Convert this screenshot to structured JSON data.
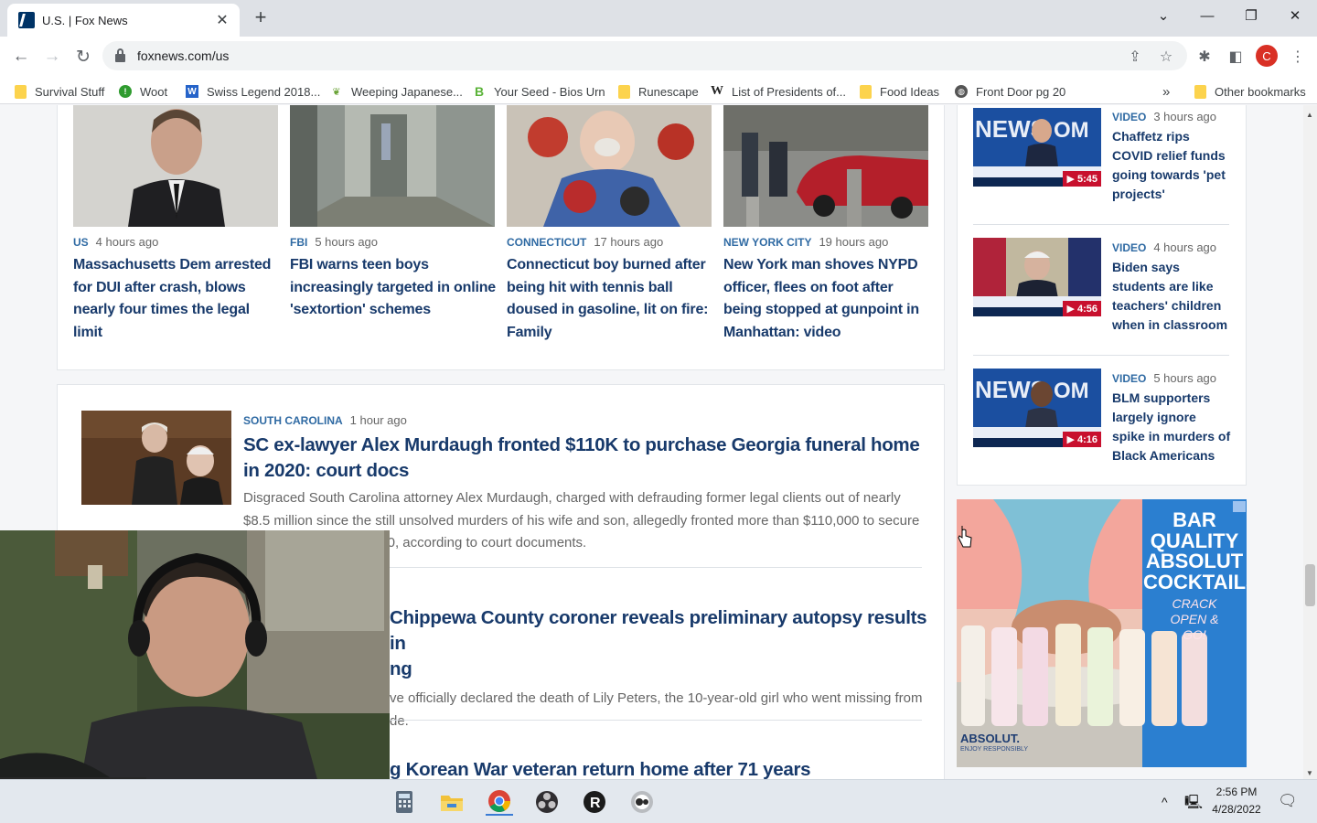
{
  "browser": {
    "tab_title": "U.S. | Fox News",
    "url": "foxnews.com/us",
    "profile_initial": "C",
    "bookmarks": [
      {
        "label": "Survival Stuff",
        "icon": "folder-icon"
      },
      {
        "label": "Woot",
        "icon": "woot-icon"
      },
      {
        "label": "Swiss Legend 2018...",
        "icon": "w-site-icon"
      },
      {
        "label": "Weeping Japanese...",
        "icon": "leaf-icon"
      },
      {
        "label": "Your Seed - Bios Urn",
        "icon": "b-site-icon"
      },
      {
        "label": "Runescape",
        "icon": "folder-icon"
      },
      {
        "label": "List of Presidents of...",
        "icon": "wikipedia-icon"
      },
      {
        "label": "Food Ideas",
        "icon": "folder-icon"
      },
      {
        "label": "Front Door pg 20",
        "icon": "globe-icon"
      }
    ],
    "bookmarks_overflow": "»",
    "other_bookmarks": "Other bookmarks"
  },
  "top_stories": [
    {
      "kicker": "US",
      "time": "4 hours ago",
      "headline": "Massachusetts Dem arrested for DUI after crash, blows nearly four times the legal limit"
    },
    {
      "kicker": "FBI",
      "time": "5 hours ago",
      "headline": "FBI warns teen boys increasingly targeted in online 'sextortion' schemes"
    },
    {
      "kicker": "CONNECTICUT",
      "time": "17 hours ago",
      "headline": "Connecticut boy burned after being hit with tennis ball doused in gasoline, lit on fire: Family"
    },
    {
      "kicker": "NEW YORK CITY",
      "time": "19 hours ago",
      "headline": "New York man shoves NYPD officer, flees on foot after being stopped at gunpoint in Manhattan: video"
    }
  ],
  "list_stories": [
    {
      "kicker": "SOUTH CAROLINA",
      "time": "1 hour ago",
      "headline": "SC ex-lawyer Alex Murdaugh fronted $110K to purchase Georgia funeral home in 2020: court docs",
      "dek": "Disgraced South Carolina attorney Alex Murdaugh, charged with defrauding former legal clients out of nearly $8.5 million since the still unsolved murders of his wife and son, allegedly fronted more than $110,000 to secure the funeral home in 2020, according to court documents."
    },
    {
      "headline_visible": "Chippewa County coroner reveals preliminary autopsy results in",
      "headline_line2": "ng",
      "dek_line1": "ve officially declared the death of Lily Peters, the 10-year-old girl who went missing from",
      "dek_line2": "de."
    },
    {
      "headline_visible": "g Korean War veteran return home after 71 years"
    }
  ],
  "videos": [
    {
      "kicker": "VIDEO",
      "time": "3 hours ago",
      "headline": "Chaffetz rips COVID relief funds going towards 'pet projects'",
      "duration": "5:45"
    },
    {
      "kicker": "VIDEO",
      "time": "4 hours ago",
      "headline": "Biden says students are like teachers' children when in classroom",
      "duration": "4:56"
    },
    {
      "kicker": "VIDEO",
      "time": "5 hours ago",
      "headline": "BLM supporters largely ignore spike in murders of Black Americans",
      "duration": "4:16"
    }
  ],
  "ad": {
    "headline_lines": [
      "BAR",
      "QUALITY",
      "ABSOLUT",
      "COCKTAILS"
    ],
    "tagline": "CRACK OPEN & GO!",
    "brand": "ABSOLUT.",
    "fine_print": "ENJOY RESPONSIBLY"
  },
  "taskbar": {
    "time": "2:56 PM",
    "date": "4/28/2022",
    "apps": [
      "calculator-icon",
      "file-explorer-icon",
      "chrome-icon",
      "obs-icon",
      "roblox-icon",
      "steam-icon"
    ]
  }
}
